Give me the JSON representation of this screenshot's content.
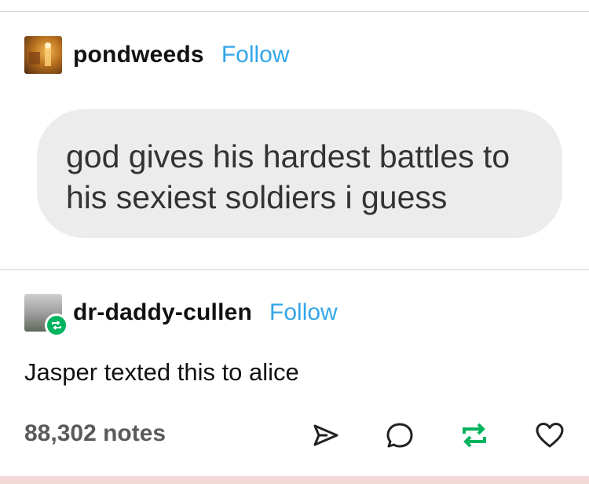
{
  "posts": [
    {
      "username": "pondweeds",
      "follow_label": "Follow",
      "avatar_icon": "pondweeds-avatar-icon",
      "message": "god gives his hardest battles to his sexiest soldiers i guess"
    },
    {
      "username": "dr-daddy-cullen",
      "follow_label": "Follow",
      "avatar_icon": "dr-daddy-cullen-avatar-icon",
      "reblog_badge_icon": "reblog-icon",
      "text": "Jasper texted this to alice"
    }
  ],
  "footer": {
    "notes": "88,302 notes",
    "actions": [
      "share-icon",
      "reply-icon",
      "reblog-icon",
      "heart-icon"
    ]
  },
  "colors": {
    "follow": "#32a6e8",
    "reblog": "#00b35e",
    "bubble": "#ececec",
    "bottom_strip": "#f4d8d8"
  }
}
